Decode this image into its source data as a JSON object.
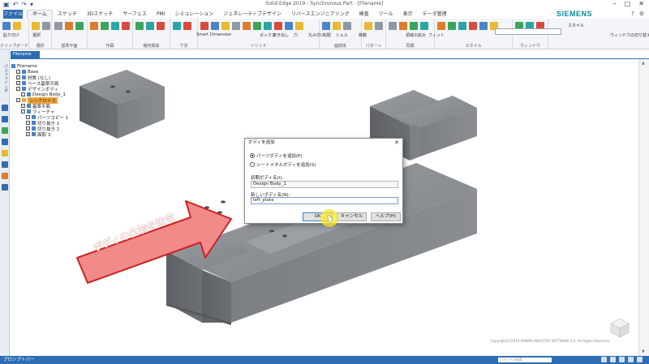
{
  "window": {
    "title": "Solid Edge 2019 - Synchronous Part - [Filename]",
    "brand": "SIEMENS"
  },
  "menu": {
    "file": "ファイル",
    "tabs": [
      "ホーム",
      "スケッチ",
      "3Dスケッチ",
      "サーフェス",
      "PMI",
      "シミュレーション",
      "ジェネレーティブデザイン",
      "リバースエンジニアリング",
      "検査",
      "ツール",
      "表示",
      "データ管理"
    ],
    "active_tab": "ホーム"
  },
  "ribbon": {
    "groups": [
      "クリップボード",
      "選択",
      "基準平面",
      "作図",
      "幾何関係",
      "寸法",
      "ソリッド",
      "面関係",
      "パターン",
      "同期",
      "スタイル",
      "ウィンドウ"
    ],
    "labels": {
      "paste": "貼り付け",
      "select": "選択",
      "smart_dimension": "Smart Dimension",
      "box": "ボックス",
      "extrude": "突き出し",
      "hole": "穴",
      "round": "丸み付け",
      "draft": "勾配",
      "shell": "シェル",
      "move": "移動",
      "face_relate": "領域の拡大",
      "fit": "フィット",
      "style": "スタイル",
      "window": "ウィンドウの切り替え"
    }
  },
  "leftbar": {
    "vertical_label": "パスファインダ"
  },
  "pathfinder": {
    "tab": "Filename",
    "items": [
      {
        "label": "Filename",
        "level": 0,
        "style": "normal"
      },
      {
        "label": "Base",
        "level": 1,
        "style": "normal"
      },
      {
        "label": "材質 (なし)",
        "level": 1,
        "style": "normal"
      },
      {
        "label": "ベース基準平面",
        "level": 1,
        "style": "normal"
      },
      {
        "label": "デザインボディ",
        "level": 1,
        "style": "normal"
      },
      {
        "label": "Design Body_1",
        "level": 2,
        "style": "normal"
      },
      {
        "label": "シンクロナス",
        "level": 1,
        "style": "orange"
      },
      {
        "label": "基準平面",
        "level": 2,
        "style": "normal"
      },
      {
        "label": "フィーチャ",
        "level": 2,
        "style": "normal"
      },
      {
        "label": "パーツコピー 1",
        "level": 3,
        "style": "normal"
      },
      {
        "label": "切り抜き 1",
        "level": 3,
        "style": "normal"
      },
      {
        "label": "切り抜き 2",
        "level": 3,
        "style": "normal"
      },
      {
        "label": "面取 3",
        "level": 3,
        "style": "normal"
      }
    ]
  },
  "dialog": {
    "title": "ボディを追加",
    "radio_part": "パーツボディを追加(P)",
    "radio_sheet": "シートメタルボディを追加(S)",
    "radio_selected": "part",
    "template_label": "初期ボディ名(I):",
    "template_value": "Design Body_1",
    "new_label": "新しいボディ名(N):",
    "new_value": "left_plate",
    "ok": "OK",
    "cancel": "キャンセル",
    "help": "ヘルプ(H)"
  },
  "callout": {
    "text": "ボディの名前を設定",
    "fill": "#f28a8a",
    "stroke": "#cc2222"
  },
  "viewport": {
    "copyright": "Copyright(C)2019 SIMENS INDUSTRY SOFTWARE K.K. All Rights Reserved."
  },
  "statusbar": {
    "left": "プロンプトバー",
    "search_placeholder": "コマンドの検索"
  },
  "colors": {
    "accent": "#2e6db4",
    "brand": "#0a8c9a",
    "metal_top": "#8d9196",
    "metal_left": "#65696e",
    "metal_right": "#787c81"
  }
}
